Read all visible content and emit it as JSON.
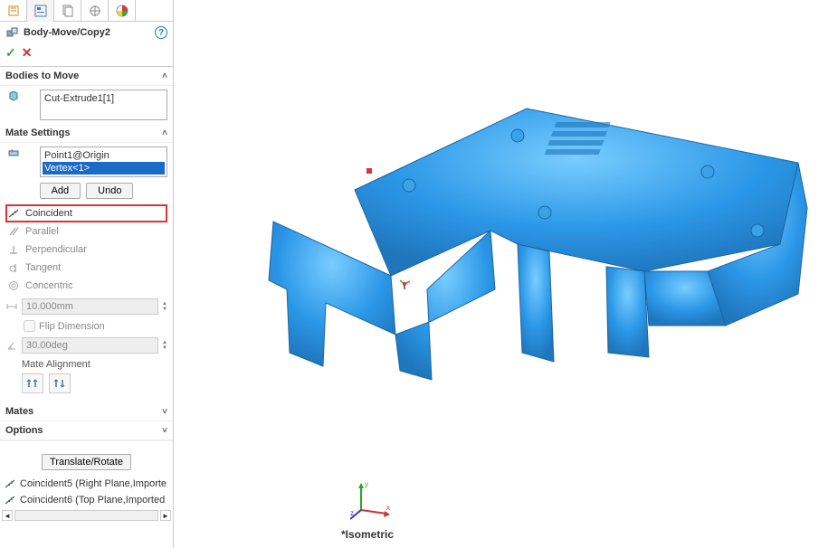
{
  "feature": {
    "title": "Body-Move/Copy2",
    "ok": "✓",
    "cancel": "✕"
  },
  "sections": {
    "bodies_head": "Bodies to Move",
    "bodies_item": "Cut-Extrude1[1]",
    "mate_settings_head": "Mate Settings",
    "mate_ref1": "Point1@Origin",
    "mate_ref2": "Vertex<1>",
    "add": "Add",
    "undo": "Undo",
    "mates": {
      "coincident": "Coincident",
      "parallel": "Parallel",
      "perpendicular": "Perpendicular",
      "tangent": "Tangent",
      "concentric": "Concentric"
    },
    "distance": "10.000mm",
    "flip": "Flip Dimension",
    "angle": "30.00deg",
    "alignment_head": "Mate Alignment",
    "mates_head": "Mates",
    "options_head": "Options",
    "translate": "Translate/Rotate",
    "existing_mates": [
      "Coincident5 (Right Plane,Importe",
      "Coincident6 (Top Plane,Imported"
    ]
  },
  "view": {
    "label": "*Isometric"
  },
  "chevron_down": "˄",
  "chevron_collapsed": "˅"
}
